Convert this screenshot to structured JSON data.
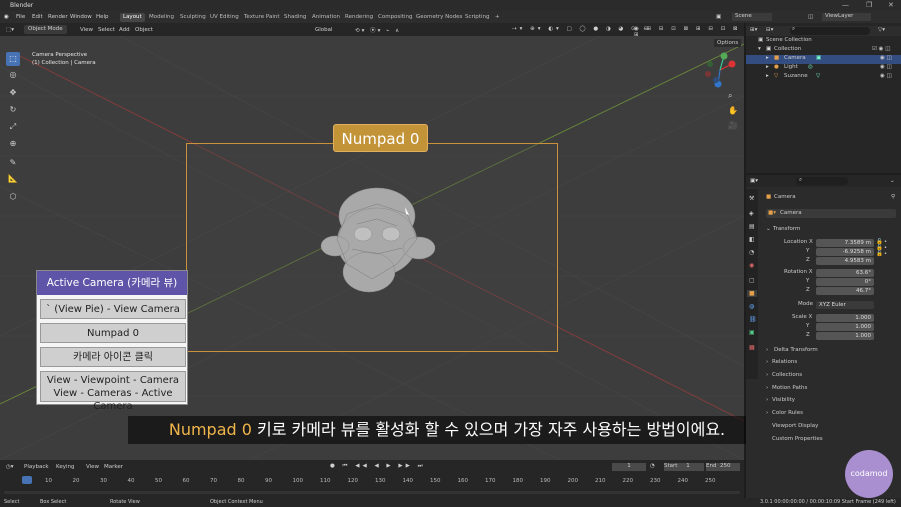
{
  "titlebar": {
    "title": "Blender",
    "controls": [
      "—",
      "❐",
      "✕"
    ]
  },
  "menubar": {
    "menus": [
      "File",
      "Edit",
      "Render",
      "Window",
      "Help"
    ],
    "workspaces": [
      "Layout",
      "Modeling",
      "Sculpting",
      "UV Editing",
      "Texture Paint",
      "Shading",
      "Animation",
      "Rendering",
      "Compositing",
      "Geometry Nodes",
      "Scripting",
      "+"
    ],
    "active_workspace": "Layout",
    "scene": "Scene",
    "view_layer": "ViewLayer"
  },
  "viewport": {
    "mode": "Object Mode",
    "menus": [
      "View",
      "Select",
      "Add",
      "Object"
    ],
    "orientation": "Global",
    "options": "Options",
    "info_line1": "Camera Perspective",
    "info_line2": "(1) Collection | Camera",
    "camera_label": "Numpad 0"
  },
  "panel": {
    "items": [
      "Active Camera (카메라 뷰)",
      "` (View Pie) - View Camera",
      "Numpad 0",
      "카메라 아이콘 클릭",
      "View - Viewpoint - Camera",
      "View - Cameras - Active Camera"
    ]
  },
  "subtitle": {
    "highlight": "Numpad 0",
    "text": " 키로 카메라 뷰를 활성화 할 수 있으며 가장 자주 사용하는 방법이에요."
  },
  "timeline": {
    "menus": [
      "Playback",
      "Keying",
      "View",
      "Marker"
    ],
    "current_frame": "1",
    "start_label": "Start",
    "start": "1",
    "end_label": "End",
    "end": "250",
    "ticks": [
      "1",
      "10",
      "20",
      "30",
      "40",
      "50",
      "60",
      "70",
      "80",
      "90",
      "100",
      "110",
      "120",
      "130",
      "140",
      "150",
      "160",
      "170",
      "180",
      "190",
      "200",
      "210",
      "220",
      "230",
      "240",
      "250"
    ]
  },
  "statusbar": {
    "items": [
      "Select",
      "Box Select",
      "Rotate View",
      "Object Context Menu"
    ],
    "right": "3.0.1   00:00:00:00 / 00:00:10:09   Start Frame (249 left)"
  },
  "outliner": {
    "scene_collection": "Scene Collection",
    "collection": "Collection",
    "objects": [
      {
        "name": "Camera",
        "selected": true
      },
      {
        "name": "Light",
        "selected": false
      },
      {
        "name": "Suzanne",
        "selected": false
      }
    ]
  },
  "properties": {
    "object_name": "Camera",
    "data_name": "Camera",
    "transform_label": "Transform",
    "location_label": "Location X",
    "rotation_label": "Rotation X",
    "scale_label": "Scale X",
    "mode_label": "Mode",
    "mode_value": "XYZ Euler",
    "location": [
      "7.3589 m",
      "-6.9258 m",
      "4.9583 m"
    ],
    "rotation": [
      "63.6°",
      "0°",
      "46.7°"
    ],
    "scale": [
      "1.000",
      "1.000",
      "1.000"
    ],
    "axis_y": "Y",
    "axis_z": "Z",
    "sections": [
      "Delta Transform",
      "Relations",
      "Collections",
      "Motion Paths",
      "Visibility",
      "Color Rules",
      "Viewport Display",
      "Custom Properties"
    ]
  },
  "logo": {
    "text": "codamod"
  }
}
